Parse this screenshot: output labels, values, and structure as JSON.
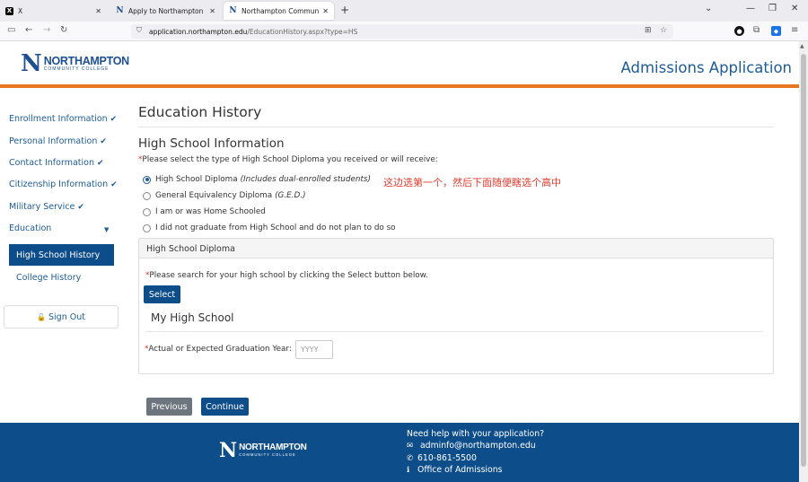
{
  "browser": {
    "tabs": [
      {
        "title": "X",
        "favicon": "x-logo-icon",
        "active": false
      },
      {
        "title": "Apply to Northampton Commu",
        "favicon": "ncc-n-icon",
        "active": false
      },
      {
        "title": "Northampton Community Col",
        "favicon": "ncc-n-icon",
        "active": true
      }
    ],
    "new_tab": "+",
    "url_domain": "application.northampton.edu",
    "url_path": "/EducationHistory.aspx?type=HS"
  },
  "header": {
    "logo_letter": "N",
    "logo_word": "NORTHAMPTON",
    "logo_sub": "COMMUNITY COLLEGE",
    "app_title": "Admissions Application",
    "brand_blue": "#1d4f91",
    "accent_orange": "#e87722"
  },
  "sidebar": {
    "items": [
      {
        "label": "Enrollment Information",
        "complete": true
      },
      {
        "label": "Personal Information",
        "complete": true
      },
      {
        "label": "Contact Information",
        "complete": true
      },
      {
        "label": "Citizenship Information",
        "complete": true
      },
      {
        "label": "Military Service",
        "complete": true
      },
      {
        "label": "Education",
        "expanded": true
      }
    ],
    "sub_items": [
      {
        "label": "High School History",
        "active": true
      },
      {
        "label": "College History",
        "active": false
      }
    ],
    "signout": "Sign Out"
  },
  "main": {
    "page_title": "Education History",
    "section_title": "High School Information",
    "required_mark": "*",
    "diploma_prompt": "Please select the type of High School Diploma you received or will receive:",
    "options": [
      {
        "label": "High School Diploma",
        "note": "(Includes dual-enrolled students)",
        "selected": true
      },
      {
        "label": "General Equivalency Diploma",
        "note": "(G.E.D.)",
        "selected": false
      },
      {
        "label": "I am or was Home Schooled",
        "note": "",
        "selected": false
      },
      {
        "label": "I did not graduate from High School and do not plan to do so",
        "note": "",
        "selected": false
      }
    ],
    "annotation": "这边选第一个，然后下面随便瞎选个高中",
    "panel": {
      "header": "High School Diploma",
      "search_prompt": "Please search for your high school by clicking the Select button below.",
      "select_button": "Select",
      "school_label": "My High School",
      "grad_year_label": "Actual or Expected Graduation Year:",
      "grad_year_placeholder": "YYYY"
    },
    "previous_button": "Previous",
    "continue_button": "Continue"
  },
  "footer": {
    "help_title": "Need help with your application?",
    "email": "adminfo@northampton.edu",
    "phone": "610-861-5500",
    "office": "Office of Admissions",
    "bg_color": "#0d4d8a"
  }
}
